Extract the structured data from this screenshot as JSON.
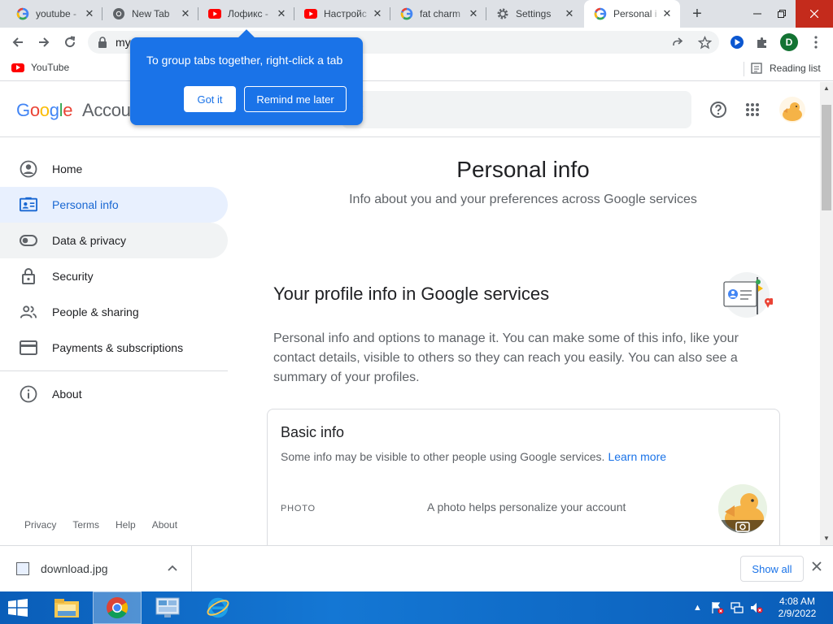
{
  "browser": {
    "tabs": [
      {
        "title": "youtube -",
        "icon": "google-g-icon",
        "active": false
      },
      {
        "title": "New Tab",
        "icon": "chrome-icon",
        "active": false
      },
      {
        "title": "Лофикс -",
        "icon": "youtube-icon",
        "active": false
      },
      {
        "title": "Настройс",
        "icon": "youtube-icon",
        "active": false
      },
      {
        "title": "fat charm",
        "icon": "google-g-icon",
        "active": false
      },
      {
        "title": "Settings",
        "icon": "gear-icon",
        "active": false
      },
      {
        "title": "Personal i",
        "icon": "google-g-icon",
        "active": true
      }
    ],
    "url_text": "my",
    "profile_letter": "D",
    "bookmarks": [
      {
        "label": "YouTube"
      }
    ],
    "reading_list": "Reading list"
  },
  "popup": {
    "text": "To group tabs together, right-click a tab",
    "got_it": "Got it",
    "remind_later": "Remind me later"
  },
  "header": {
    "logo_google": "Google",
    "logo_account": "Accou",
    "search_placeholder_fragment": "t"
  },
  "sidenav": {
    "items": [
      {
        "label": "Home",
        "icon": "account-circle-icon"
      },
      {
        "label": "Personal info",
        "icon": "id-card-icon"
      },
      {
        "label": "Data & privacy",
        "icon": "toggle-icon"
      },
      {
        "label": "Security",
        "icon": "lock-icon"
      },
      {
        "label": "People & sharing",
        "icon": "people-icon"
      },
      {
        "label": "Payments & subscriptions",
        "icon": "credit-card-icon"
      }
    ],
    "about": {
      "label": "About",
      "icon": "info-icon"
    },
    "footer": [
      "Privacy",
      "Terms",
      "Help",
      "About"
    ]
  },
  "main": {
    "title": "Personal info",
    "subtitle": "Info about you and your preferences across Google services",
    "section_title": "Your profile info in Google services",
    "section_desc": "Personal info and options to manage it. You can make some of this info, like your contact details, visible to others so they can reach you easily. You can also see a summary of your profiles.",
    "card": {
      "title": "Basic info",
      "desc": "Some info may be visible to other people using Google services.",
      "learn_more": "Learn more",
      "photo_label": "PHOTO",
      "photo_desc": "A photo helps personalize your account"
    }
  },
  "downloads": {
    "file": "download.jpg",
    "show_all": "Show all"
  },
  "taskbar": {
    "time": "4:08 AM",
    "date": "2/9/2022"
  },
  "colors": {
    "accent": "#1a73e8",
    "active_nav_bg": "#e8f0fe",
    "taskbar": "#0a5db8"
  }
}
